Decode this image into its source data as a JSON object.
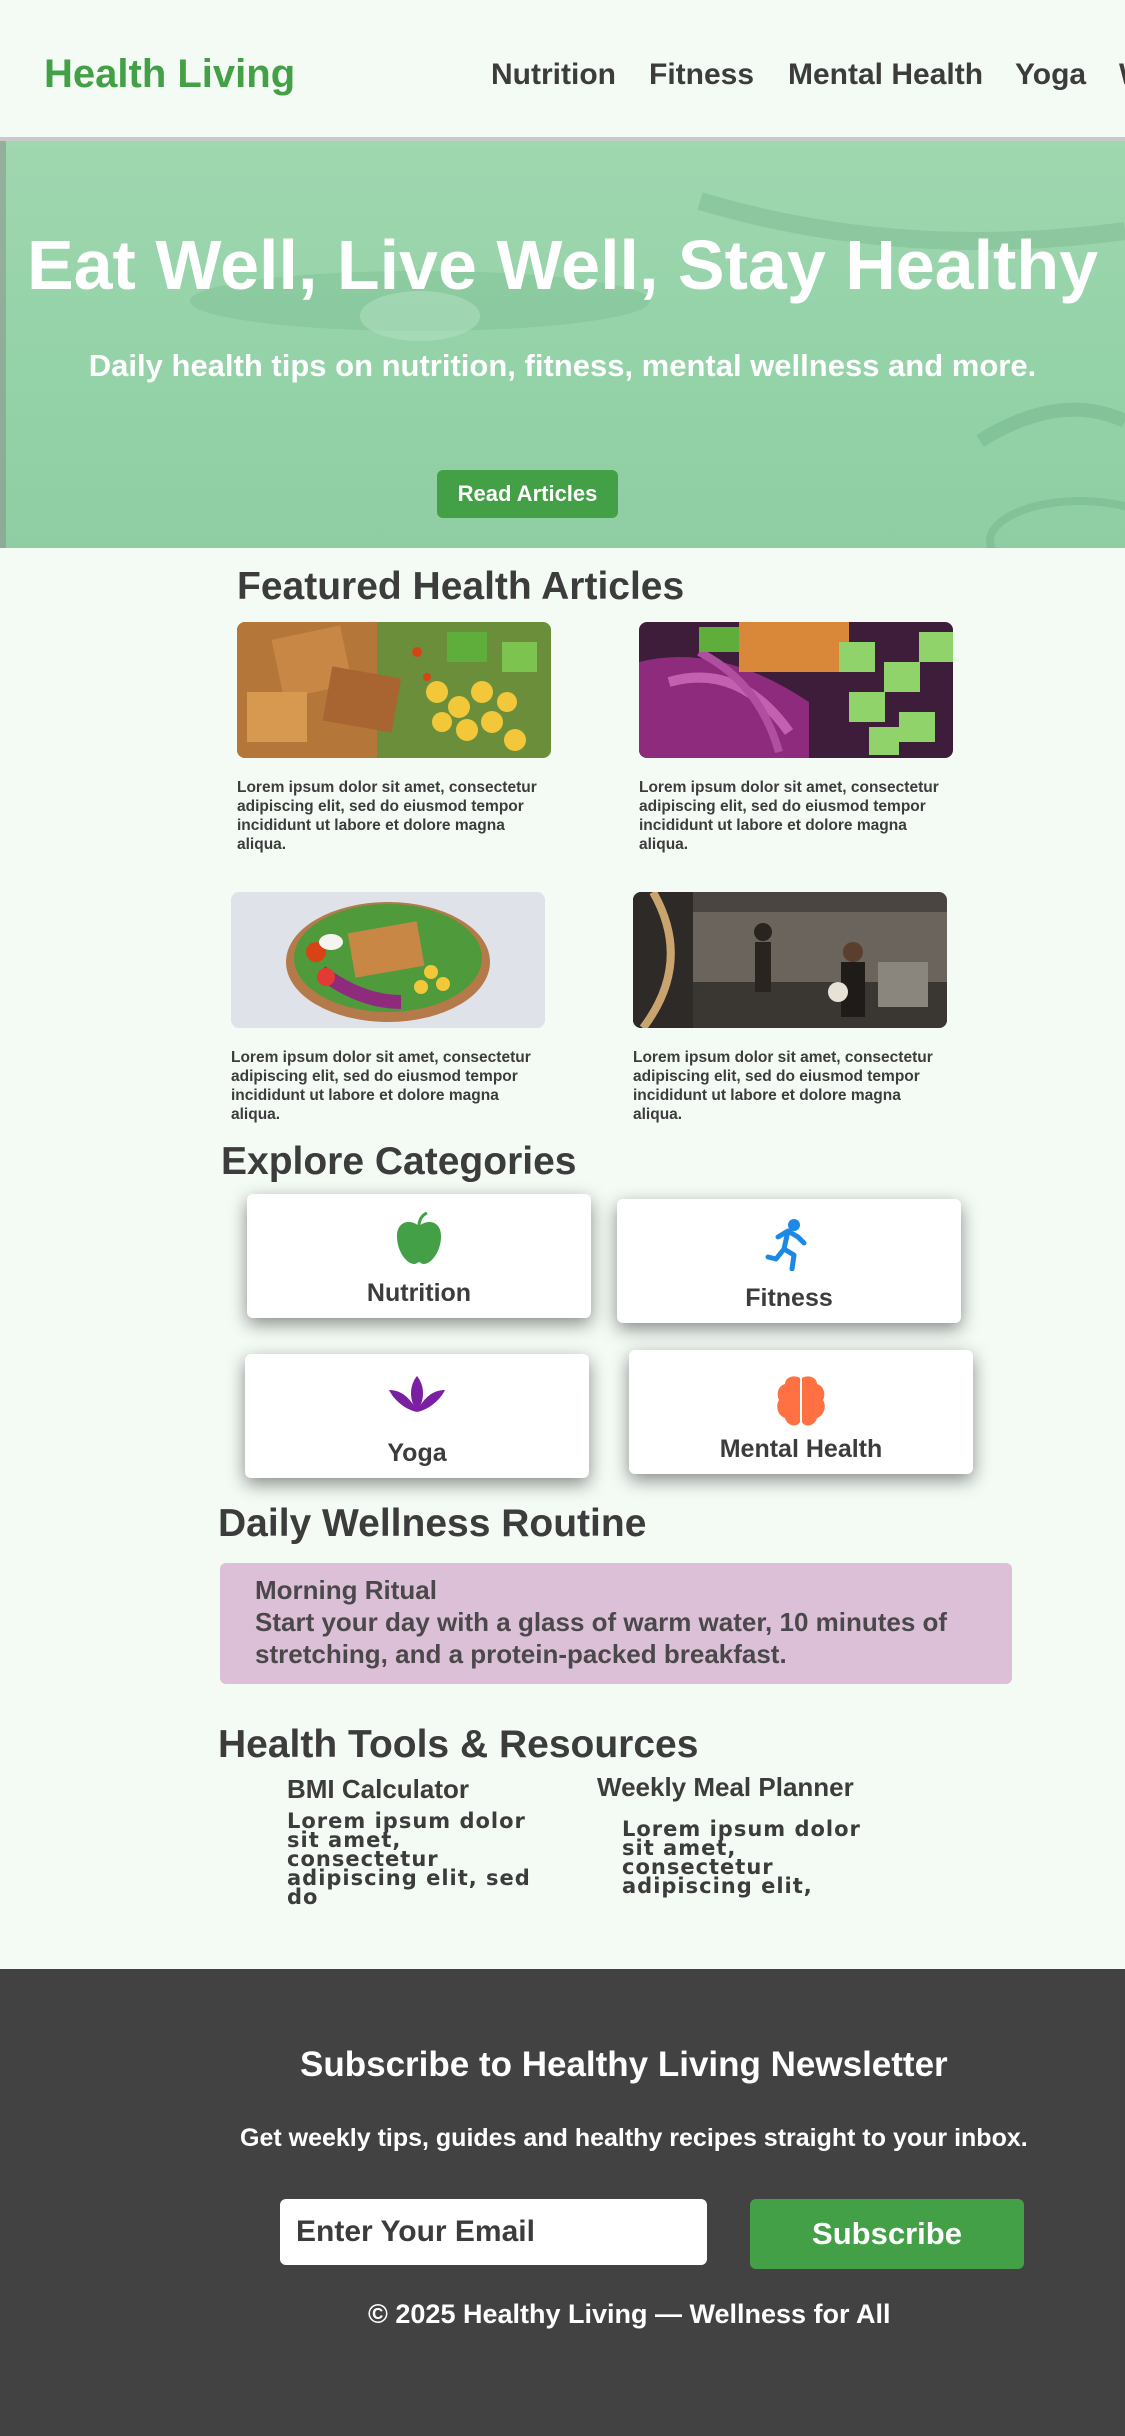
{
  "header": {
    "brand": "Health Living",
    "nav": [
      "Nutrition",
      "Fitness",
      "Mental Health",
      "Yoga",
      "W"
    ]
  },
  "hero": {
    "title": "Eat Well, Live Well, Stay Healthy",
    "subtitle": "Daily health tips on nutrition, fitness, mental wellness and more.",
    "button": "Read Articles"
  },
  "featured": {
    "heading": "Featured Health Articles",
    "articles": [
      {
        "image": "tofu-corn-salad-photo",
        "text": "Lorem ipsum dolor sit amet, consectetur adipiscing elit, sed do eiusmod tempor incididunt ut labore et dolore magna aliqua."
      },
      {
        "image": "cabbage-cucumber-salad-photo",
        "text": "Lorem ipsum dolor sit amet, consectetur adipiscing elit, sed do eiusmod tempor incididunt ut labore et dolore magna aliqua."
      },
      {
        "image": "salad-bowl-photo",
        "text": "Lorem ipsum dolor sit amet, consectetur adipiscing elit, sed do eiusmod tempor incididunt ut labore et dolore magna aliqua."
      },
      {
        "image": "gym-workout-photo",
        "text": "Lorem ipsum dolor sit amet, consectetur adipiscing elit, sed do eiusmod tempor incididunt ut labore et dolore magna aliqua."
      }
    ]
  },
  "categories": {
    "heading": "Explore Categories",
    "items": [
      {
        "label": "Nutrition",
        "icon": "apple-icon",
        "color": "#43a047"
      },
      {
        "label": "Fitness",
        "icon": "running-icon",
        "color": "#1e88e5"
      },
      {
        "label": "Yoga",
        "icon": "lotus-icon",
        "color": "#7b1fa2"
      },
      {
        "label": "Mental Health",
        "icon": "brain-icon",
        "color": "#ff7043"
      }
    ]
  },
  "routine": {
    "heading": "Daily Wellness Routine",
    "title": "Morning Ritual",
    "text": "Start your day with a glass of warm water, 10 minutes of stretching, and a protein-packed breakfast."
  },
  "tools": {
    "heading": "Health Tools & Resources",
    "items": [
      {
        "title": "BMI Calculator",
        "text": "Lorem ipsum dolor sit amet, consectetur adipiscing elit, sed do"
      },
      {
        "title": "Weekly Meal Planner",
        "text": "Lorem ipsum dolor sit amet, consectetur adipiscing elit,"
      }
    ]
  },
  "footer": {
    "title": "Subscribe to Healthy Living Newsletter",
    "subtitle": "Get weekly tips, guides and healthy recipes straight to your inbox.",
    "email_placeholder": "Enter Your Email",
    "button": "Subscribe",
    "copyright": "© 2025 Healthy Living — Wellness for All"
  },
  "colors": {
    "accent": "#43a047",
    "hero": "#96d3aa",
    "routine_card": "#dcc0d8",
    "footer": "#424242"
  }
}
